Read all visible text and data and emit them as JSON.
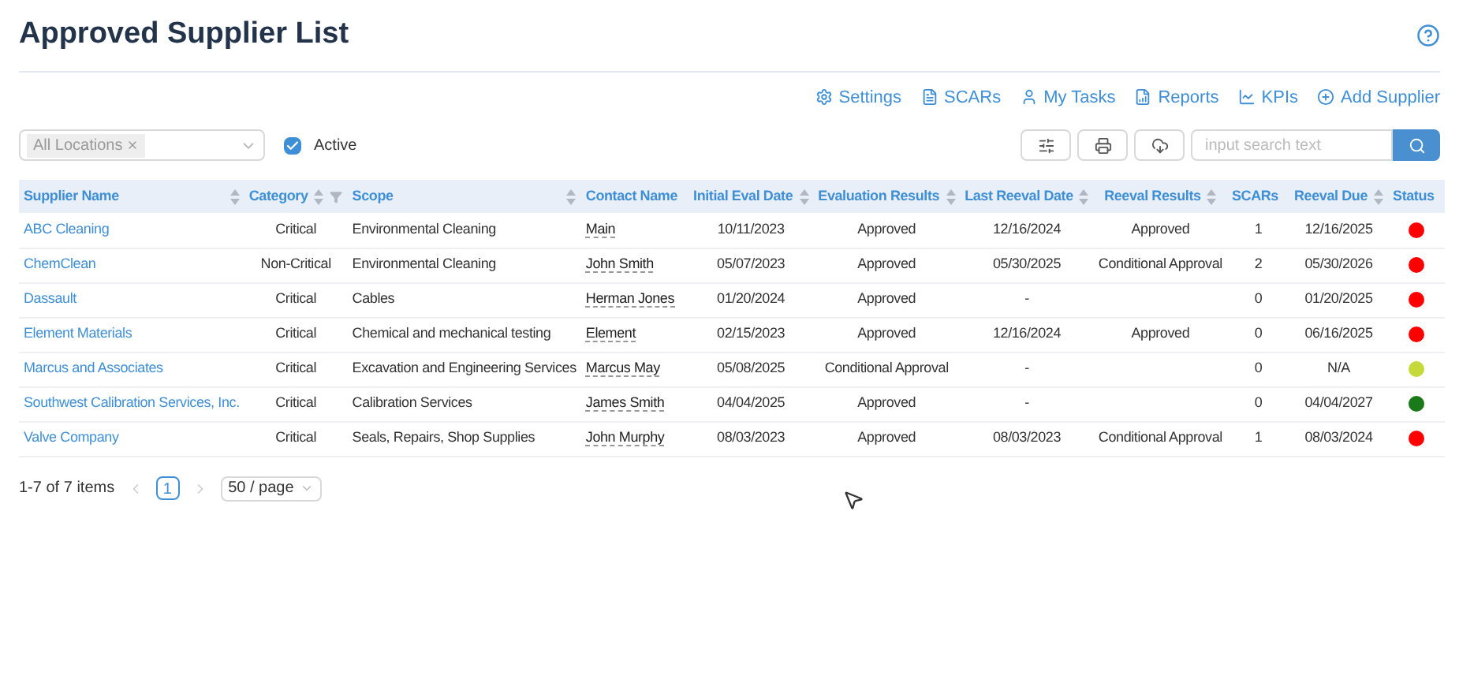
{
  "title": "Approved Supplier List",
  "actions": [
    {
      "label": "Settings",
      "kind": "settings"
    },
    {
      "label": "SCARs",
      "kind": "document"
    },
    {
      "label": "My Tasks",
      "kind": "user"
    },
    {
      "label": "Reports",
      "kind": "report"
    },
    {
      "label": "KPIs",
      "kind": "chart"
    },
    {
      "label": "Add Supplier",
      "kind": "add"
    }
  ],
  "filters": {
    "location_tag": "All Locations",
    "active": {
      "label": "Active",
      "checked": true
    }
  },
  "search": {
    "placeholder": "input search text"
  },
  "table": {
    "columns": [
      {
        "label": "Supplier Name",
        "sortable": true,
        "filter": false
      },
      {
        "label": "Category",
        "sortable": true,
        "filter": true
      },
      {
        "label": "Scope",
        "sortable": true,
        "filter": false
      },
      {
        "label": "Contact Name",
        "sortable": false,
        "filter": false
      },
      {
        "label": "Initial Eval Date",
        "sortable": true,
        "filter": false
      },
      {
        "label": "Evaluation Results",
        "sortable": true,
        "filter": false
      },
      {
        "label": "Last Reeval Date",
        "sortable": true,
        "filter": false
      },
      {
        "label": "Reeval Results",
        "sortable": true,
        "filter": false
      },
      {
        "label": "SCARs",
        "sortable": false,
        "filter": false
      },
      {
        "label": "Reeval Due",
        "sortable": true,
        "filter": false
      },
      {
        "label": "Status",
        "sortable": false,
        "filter": false
      }
    ],
    "rows": [
      {
        "supplier": "ABC Cleaning",
        "category": "Critical",
        "scope": "Environmental Cleaning",
        "contact": "Main",
        "initial_eval": "10/11/2023",
        "eval_result": "Approved",
        "last_reeval": "12/16/2024",
        "reeval_result": "Approved",
        "scars": "1",
        "reeval_due": "12/16/2025",
        "color": "#ff0000"
      },
      {
        "supplier": "ChemClean",
        "category": "Non-Critical",
        "scope": "Environmental Cleaning",
        "contact": "John Smith",
        "initial_eval": "05/07/2023",
        "eval_result": "Approved",
        "last_reeval": "05/30/2025",
        "reeval_result": "Conditional Approval",
        "scars": "2",
        "reeval_due": "05/30/2026",
        "color": "#ff0000"
      },
      {
        "supplier": "Dassault",
        "category": "Critical",
        "scope": "Cables",
        "contact": "Herman Jones",
        "initial_eval": "01/20/2024",
        "eval_result": "Approved",
        "last_reeval": "-",
        "scars": "0",
        "reeval_due": "01/20/2025",
        "color": "#ff0000"
      },
      {
        "supplier": "Element Materials",
        "category": "Critical",
        "scope": "Chemical and mechanical testing",
        "contact": "Element",
        "initial_eval": "02/15/2023",
        "eval_result": "Approved",
        "last_reeval": "12/16/2024",
        "reeval_result": "Approved",
        "scars": "0",
        "reeval_due": "06/16/2025",
        "color": "#ff0000"
      },
      {
        "supplier": "Marcus and Associates",
        "category": "Critical",
        "scope": "Excavation and Engineering Services",
        "contact": "Marcus May",
        "initial_eval": "05/08/2025",
        "eval_result": "Conditional Approval",
        "last_reeval": "-",
        "scars": "0",
        "reeval_due": "N/A",
        "color": "#c5d93a"
      },
      {
        "supplier": "Southwest Calibration Services, Inc.",
        "category": "Critical",
        "scope": "Calibration Services",
        "contact": "James Smith",
        "initial_eval": "04/04/2025",
        "eval_result": "Approved",
        "last_reeval": "-",
        "scars": "0",
        "reeval_due": "04/04/2027",
        "color": "#1a7a1a"
      },
      {
        "supplier": "Valve Company",
        "category": "Critical",
        "scope": "Seals, Repairs, Shop Supplies",
        "contact": "John Murphy",
        "initial_eval": "08/03/2023",
        "eval_result": "Approved",
        "last_reeval": "08/03/2023",
        "reeval_result": "Conditional Approval",
        "scars": "1",
        "reeval_due": "08/03/2024",
        "color": "#ff0000"
      }
    ]
  },
  "pagination": {
    "summary": "1-7 of 7 items",
    "pages": [
      {
        "label": "1",
        "selected": true
      }
    ],
    "page_size": "50 / page"
  }
}
